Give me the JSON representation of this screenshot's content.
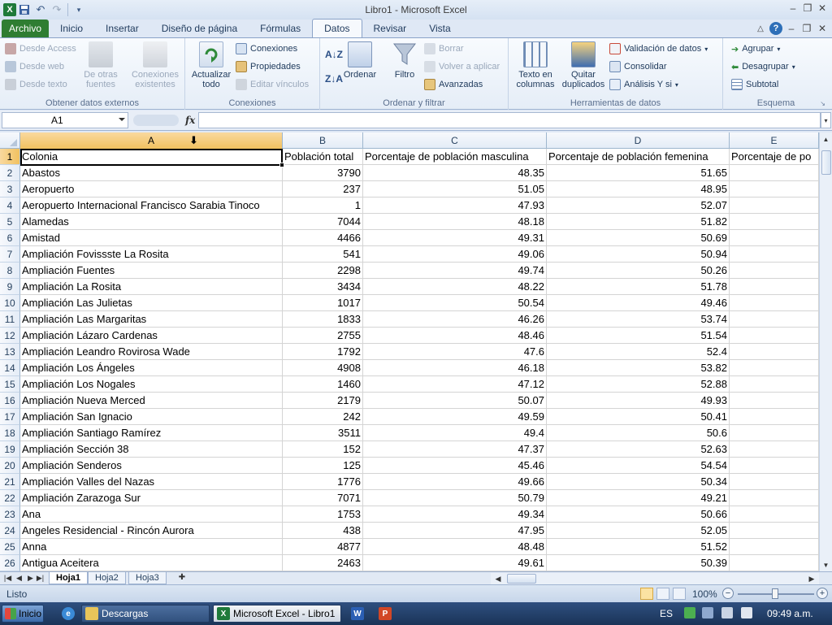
{
  "window": {
    "title": "Libro1  -  Microsoft Excel"
  },
  "ribbon": {
    "tabs": [
      "Archivo",
      "Inicio",
      "Insertar",
      "Diseño de página",
      "Fórmulas",
      "Datos",
      "Revisar",
      "Vista"
    ],
    "active_tab": "Datos",
    "groups": {
      "external": {
        "label": "Obtener datos externos",
        "access": "Desde Access",
        "web": "Desde web",
        "text": "Desde texto",
        "other_line1": "De otras",
        "other_line2": "fuentes",
        "existing_line1": "Conexiones",
        "existing_line2": "existentes"
      },
      "connections": {
        "label": "Conexiones",
        "refresh_line1": "Actualizar",
        "refresh_line2": "todo",
        "connections": "Conexiones",
        "properties": "Propiedades",
        "edit_links": "Editar vínculos"
      },
      "sort_filter": {
        "label": "Ordenar y filtrar",
        "sort": "Ordenar",
        "filter": "Filtro",
        "clear": "Borrar",
        "reapply": "Volver a aplicar",
        "advanced": "Avanzadas"
      },
      "data_tools": {
        "label": "Herramientas de datos",
        "text_to_cols_line1": "Texto en",
        "text_to_cols_line2": "columnas",
        "remove_dup_line1": "Quitar",
        "remove_dup_line2": "duplicados",
        "validation": "Validación de datos",
        "consolidate": "Consolidar",
        "whatif": "Análisis Y si"
      },
      "outline": {
        "label": "Esquema",
        "group": "Agrupar",
        "ungroup": "Desagrupar",
        "subtotal": "Subtotal"
      }
    }
  },
  "formula_bar": {
    "name_box": "A1",
    "fx": "fx",
    "formula": ""
  },
  "sheet": {
    "columns": [
      {
        "letter": "A"
      },
      {
        "letter": "B"
      },
      {
        "letter": "C"
      },
      {
        "letter": "D"
      },
      {
        "letter": "E"
      }
    ],
    "rows": [
      {
        "n": "1",
        "cells": [
          "Colonia",
          "Población total",
          "Porcentaje de población masculina",
          "Porcentaje de población femenina",
          "Porcentaje de po"
        ]
      },
      {
        "n": "2",
        "cells": [
          "Abastos",
          "3790",
          "48.35",
          "51.65",
          ""
        ]
      },
      {
        "n": "3",
        "cells": [
          "Aeropuerto",
          "237",
          "51.05",
          "48.95",
          ""
        ]
      },
      {
        "n": "4",
        "cells": [
          "Aeropuerto Internacional Francisco Sarabia Tinoco",
          "1",
          "47.93",
          "52.07",
          ""
        ]
      },
      {
        "n": "5",
        "cells": [
          "Alamedas",
          "7044",
          "48.18",
          "51.82",
          ""
        ]
      },
      {
        "n": "6",
        "cells": [
          "Amistad",
          "4466",
          "49.31",
          "50.69",
          ""
        ]
      },
      {
        "n": "7",
        "cells": [
          "Ampliación Fovissste La Rosita",
          "541",
          "49.06",
          "50.94",
          ""
        ]
      },
      {
        "n": "8",
        "cells": [
          "Ampliación Fuentes",
          "2298",
          "49.74",
          "50.26",
          ""
        ]
      },
      {
        "n": "9",
        "cells": [
          "Ampliación La Rosita",
          "3434",
          "48.22",
          "51.78",
          ""
        ]
      },
      {
        "n": "10",
        "cells": [
          "Ampliación Las Julietas",
          "1017",
          "50.54",
          "49.46",
          ""
        ]
      },
      {
        "n": "11",
        "cells": [
          "Ampliación Las Margaritas",
          "1833",
          "46.26",
          "53.74",
          ""
        ]
      },
      {
        "n": "12",
        "cells": [
          "Ampliación Lázaro Cardenas",
          "2755",
          "48.46",
          "51.54",
          ""
        ]
      },
      {
        "n": "13",
        "cells": [
          "Ampliación Leandro Rovirosa Wade",
          "1792",
          "47.6",
          "52.4",
          ""
        ]
      },
      {
        "n": "14",
        "cells": [
          "Ampliación Los Ángeles",
          "4908",
          "46.18",
          "53.82",
          ""
        ]
      },
      {
        "n": "15",
        "cells": [
          "Ampliación Los Nogales",
          "1460",
          "47.12",
          "52.88",
          ""
        ]
      },
      {
        "n": "16",
        "cells": [
          "Ampliación Nueva Merced",
          "2179",
          "50.07",
          "49.93",
          ""
        ]
      },
      {
        "n": "17",
        "cells": [
          "Ampliación San Ignacio",
          "242",
          "49.59",
          "50.41",
          ""
        ]
      },
      {
        "n": "18",
        "cells": [
          "Ampliación Santiago Ramírez",
          "3511",
          "49.4",
          "50.6",
          ""
        ]
      },
      {
        "n": "19",
        "cells": [
          "Ampliación Sección 38",
          "152",
          "47.37",
          "52.63",
          ""
        ]
      },
      {
        "n": "20",
        "cells": [
          "Ampliación Senderos",
          "125",
          "45.46",
          "54.54",
          ""
        ]
      },
      {
        "n": "21",
        "cells": [
          "Ampliación Valles del Nazas",
          "1776",
          "49.66",
          "50.34",
          ""
        ]
      },
      {
        "n": "22",
        "cells": [
          "Ampliación Zarazoga Sur",
          "7071",
          "50.79",
          "49.21",
          ""
        ]
      },
      {
        "n": "23",
        "cells": [
          "Ana",
          "1753",
          "49.34",
          "50.66",
          ""
        ]
      },
      {
        "n": "24",
        "cells": [
          "Angeles Residencial - Rincón Aurora",
          "438",
          "47.95",
          "52.05",
          ""
        ]
      },
      {
        "n": "25",
        "cells": [
          "Anna",
          "4877",
          "48.48",
          "51.52",
          ""
        ]
      },
      {
        "n": "26",
        "cells": [
          "Antigua Aceitera",
          "2463",
          "49.61",
          "50.39",
          ""
        ]
      }
    ]
  },
  "sheet_tabs": [
    "Hoja1",
    "Hoja2",
    "Hoja3"
  ],
  "active_sheet": "Hoja1",
  "status": {
    "text": "Listo",
    "zoom": "100%",
    "zoom_level": 100
  },
  "taskbar": {
    "start": "Inicio",
    "folder": "Descargas",
    "excel": "Microsoft Excel - Libro1",
    "lang": "ES",
    "clock": "09:49 a.m."
  },
  "colors": {
    "file_tab": "#2f7d32",
    "selection_header": "#f1c15f",
    "excel_green": "#1f7a3a"
  }
}
